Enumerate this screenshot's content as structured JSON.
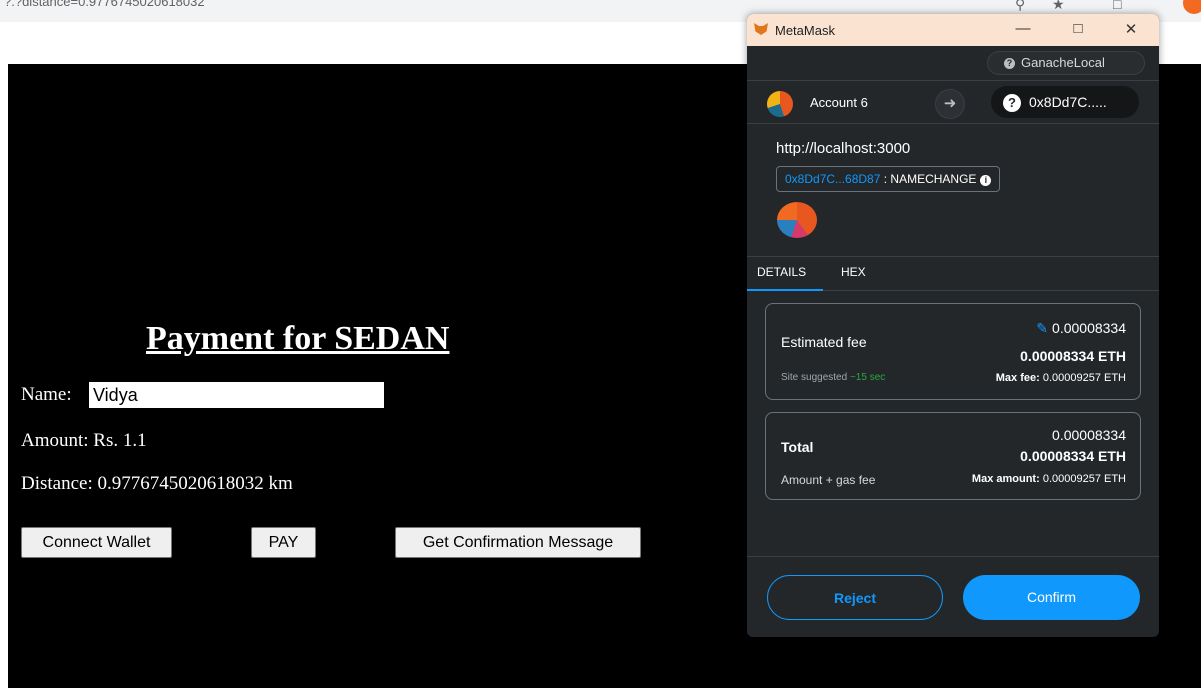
{
  "browser": {
    "url": "?.?distance=0.9776745020618032"
  },
  "page": {
    "title": "Payment for SEDAN",
    "name_label": "Name:",
    "name_value": "Vidya",
    "amount": "Amount: Rs. 1.1",
    "distance": "Distance: 0.9776745020618032 km",
    "buttons": {
      "connect": "Connect Wallet",
      "pay": "PAY",
      "confirm_msg": "Get Confirmation Message"
    }
  },
  "metamask": {
    "window_title": "MetaMask",
    "network": "GanacheLocal",
    "account": "Account 6",
    "to_address": "0x8Dd7C.....",
    "origin": "http://localhost:3000",
    "contract_address": "0x8Dd7C...68D87",
    "contract_function": ": NAMECHANGE",
    "tabs": [
      "DETAILS",
      "HEX"
    ],
    "fee": {
      "label": "Estimated fee",
      "value_small": "0.00008334",
      "value_bold": "0.00008334 ETH",
      "site_suggested": "Site suggested",
      "time": "~15 sec",
      "max_label": "Max fee:",
      "max_value": "0.00009257 ETH"
    },
    "total": {
      "label": "Total",
      "value_small": "0.00008334",
      "value_bold": "0.00008334 ETH",
      "sublabel": "Amount + gas fee",
      "max_label": "Max amount:",
      "max_value": "0.00009257 ETH"
    },
    "reject": "Reject",
    "confirm": "Confirm"
  },
  "colors": {
    "accent": "#1098fc",
    "mm_bg": "#24272a",
    "page_bg": "#000000"
  }
}
